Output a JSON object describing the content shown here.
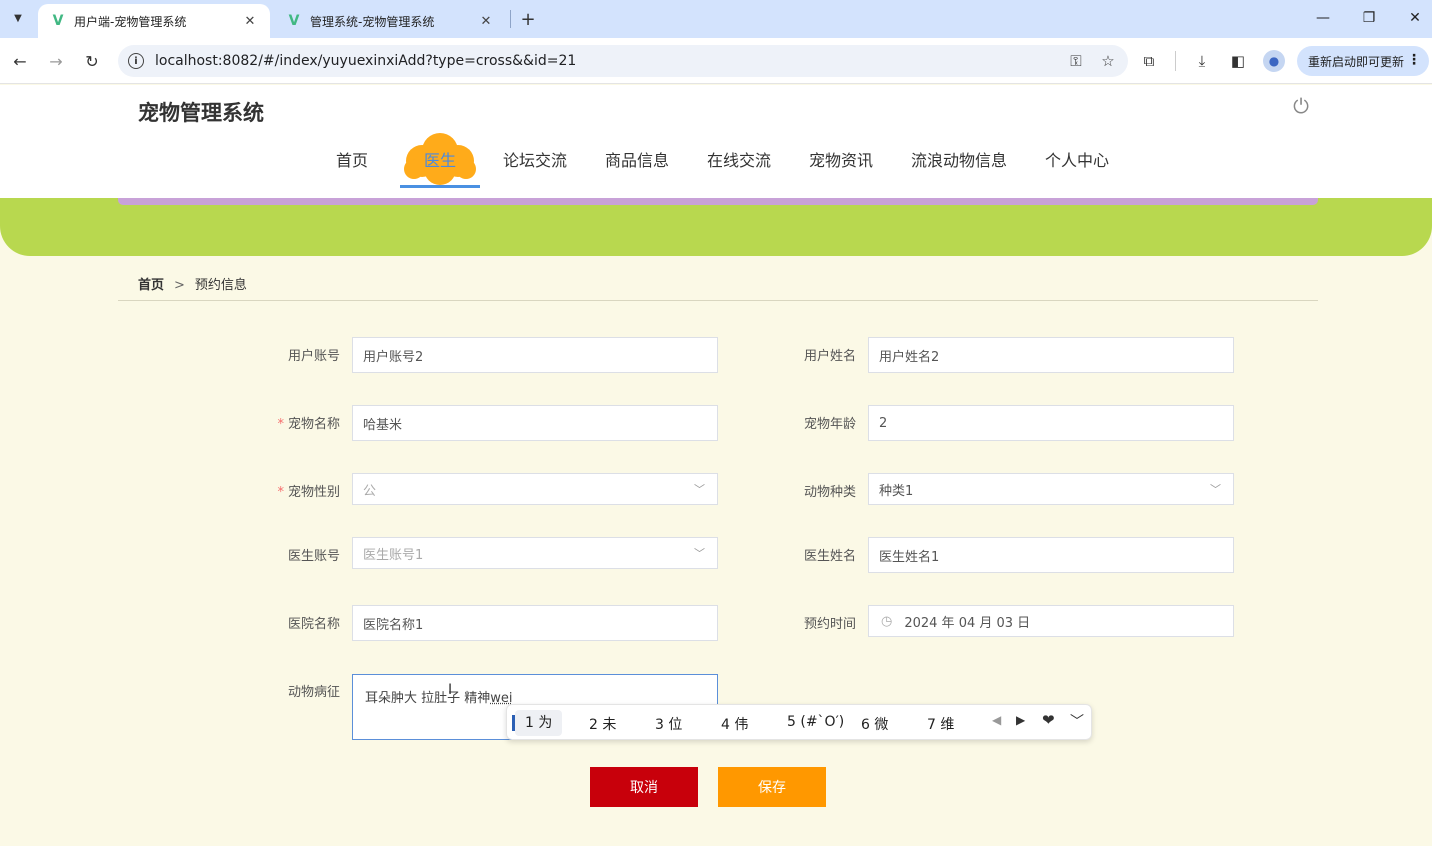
{
  "browser": {
    "tabs": [
      {
        "title": "用户端-宠物管理系统",
        "active": true
      },
      {
        "title": "管理系统-宠物管理系统",
        "active": false
      }
    ],
    "url": "localhost:8082/#/index/yuyuexinxiAdd?type=cross&&id=21",
    "update_label": "重新启动即可更新"
  },
  "site": {
    "title": "宠物管理系统",
    "nav": [
      "首页",
      "医生",
      "论坛交流",
      "商品信息",
      "在线交流",
      "宠物资讯",
      "流浪动物信息",
      "个人中心"
    ],
    "active_nav": "医生"
  },
  "breadcrumb": {
    "home": "首页",
    "separator": ">",
    "current": "预约信息"
  },
  "form": {
    "user_account": {
      "label": "用户账号",
      "value": "用户账号2"
    },
    "user_name": {
      "label": "用户姓名",
      "value": "用户姓名2"
    },
    "pet_name": {
      "label": "宠物名称",
      "value": "哈基米",
      "required": true
    },
    "pet_age": {
      "label": "宠物年龄",
      "value": "2"
    },
    "pet_gender": {
      "label": "宠物性别",
      "value": "公",
      "required": true
    },
    "animal_type": {
      "label": "动物种类",
      "value": "种类1"
    },
    "doctor_account": {
      "label": "医生账号",
      "value": "医生账号1"
    },
    "doctor_name": {
      "label": "医生姓名",
      "value": "医生姓名1"
    },
    "hospital_name": {
      "label": "医院名称",
      "value": "医院名称1"
    },
    "appointment_time": {
      "label": "预约时间",
      "value": "2024 年 04 月 03 日"
    },
    "symptoms": {
      "label": "动物病征",
      "value": "耳朵肿大 拉肚子  精神",
      "composing": "wei"
    }
  },
  "ime": {
    "candidates": [
      "1 为",
      "2 未",
      "3 位",
      "4 伟",
      "5 (#`O′)",
      "6 微",
      "7 维"
    ]
  },
  "buttons": {
    "cancel": "取消",
    "save": "保存"
  },
  "colors": {
    "accent": "#4a90e2",
    "cancel": "#c8000b",
    "save": "#ff9800",
    "banner": "#b8d84f",
    "required": "#f56c6c"
  }
}
